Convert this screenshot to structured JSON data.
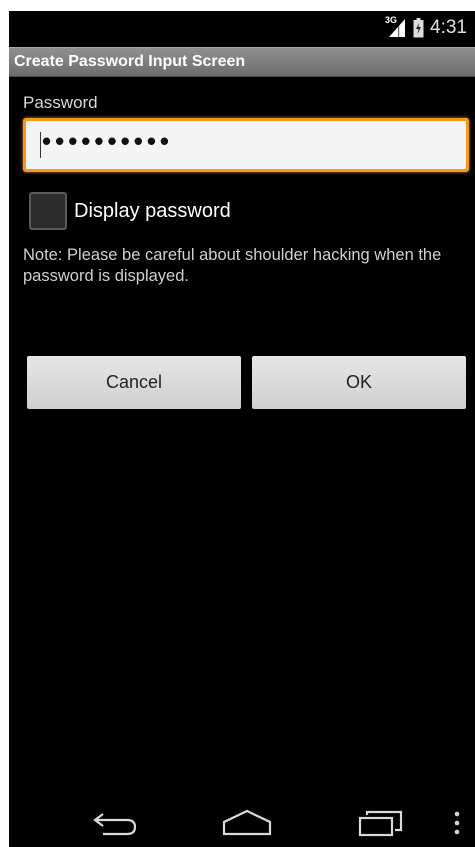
{
  "status_bar": {
    "network_type": "3G",
    "time": "4:31",
    "icons": [
      "signal-icon",
      "battery-icon"
    ]
  },
  "title_bar": {
    "title": "Create Password Input Screen"
  },
  "form": {
    "password_label": "Password",
    "password_value": "••••••••••",
    "display_password_label": "Display password",
    "display_password_checked": false,
    "note": "Note: Please be careful about shoulder hacking when the password is displayed."
  },
  "buttons": {
    "cancel_label": "Cancel",
    "ok_label": "OK"
  },
  "nav_bar": {
    "icons": [
      "back-icon",
      "home-icon",
      "recent-apps-icon",
      "menu-icon"
    ]
  },
  "colors": {
    "focus_border": "#f29a1c",
    "title_bar": "#7c7c7c",
    "background": "#000000",
    "button": "#dcdcdc"
  }
}
